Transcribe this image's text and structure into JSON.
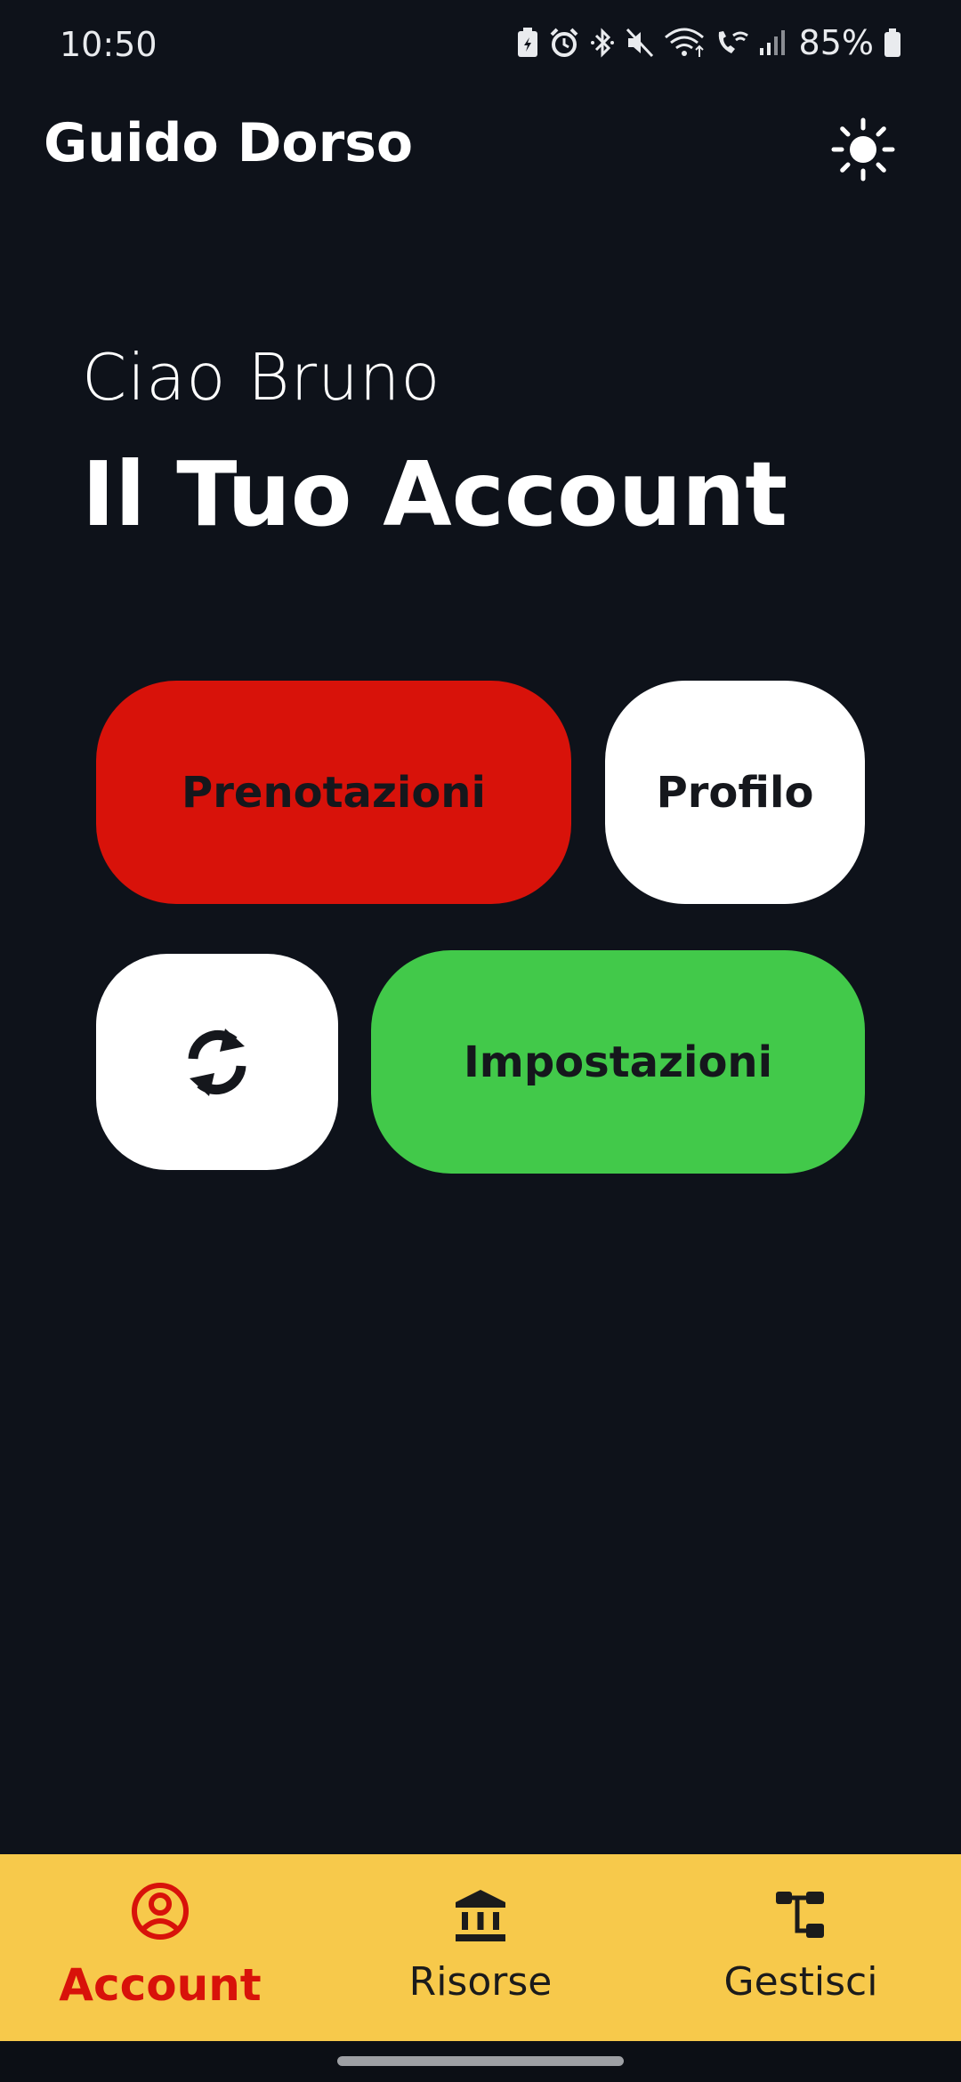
{
  "status_bar": {
    "time": "10:50",
    "battery": "85%",
    "icons": [
      "battery-saver-icon",
      "alarm-icon",
      "bluetooth-icon",
      "mute-icon",
      "wifi-icon",
      "wifi-call-icon",
      "signal-icon",
      "battery-icon"
    ]
  },
  "app_bar": {
    "title": "Guido Dorso",
    "theme_icon": "sun-icon"
  },
  "greeting": "Ciao  Bruno",
  "page_title": "Il Tuo Account",
  "buttons": {
    "bookings": "Prenotazioni",
    "profile": "Profilo",
    "refresh_icon": "refresh-icon",
    "settings": "Impostazioni"
  },
  "bottom_nav": {
    "items": [
      {
        "label": "Account",
        "icon": "account-circle-icon",
        "active": true
      },
      {
        "label": "Risorse",
        "icon": "bank-icon",
        "active": false
      },
      {
        "label": "Gestisci",
        "icon": "tree-icon",
        "active": false
      }
    ]
  },
  "colors": {
    "background": "#0e121a",
    "bookings": "#d8120a",
    "settings": "#42c94a",
    "nav_background": "#f7c94b",
    "nav_active": "#d8120a"
  }
}
